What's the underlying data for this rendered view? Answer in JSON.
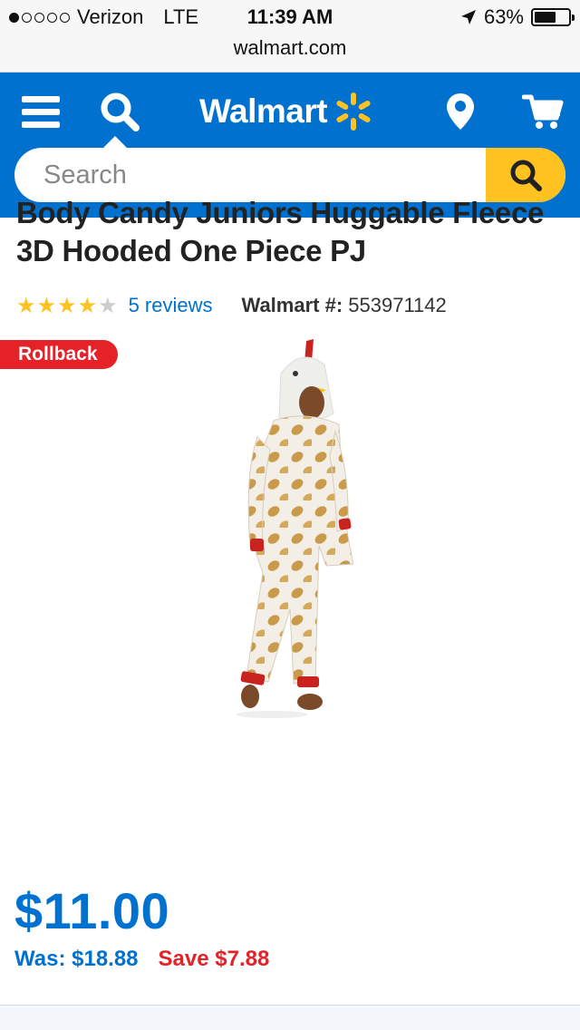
{
  "status_bar": {
    "carrier": "Verizon",
    "network": "LTE",
    "time": "11:39 AM",
    "battery": "63%",
    "battery_level": 0.63,
    "signal_bars_filled": 1,
    "signal_bars_total": 5
  },
  "browser": {
    "url": "walmart.com"
  },
  "header": {
    "logo_text": "Walmart",
    "search_placeholder": "Search",
    "colors": {
      "primary": "#0071ce",
      "accent": "#ffc220"
    },
    "icons": [
      "menu-icon",
      "search-icon",
      "spark-icon",
      "location-pin-icon",
      "cart-icon"
    ]
  },
  "product": {
    "title": "Body Candy Juniors Huggable Fleece 3D Hooded One Piece PJ",
    "rating": 4,
    "rating_max": 5,
    "reviews_link": "5 reviews",
    "item_number_label": "Walmart #:",
    "item_number": "553971142",
    "badge": "Rollback",
    "price": "$11.00",
    "was_price": "Was: $18.88",
    "savings": "Save $7.88",
    "colors": {
      "price": "#0071ce",
      "sale": "#e62229",
      "star": "#ffc220"
    }
  }
}
